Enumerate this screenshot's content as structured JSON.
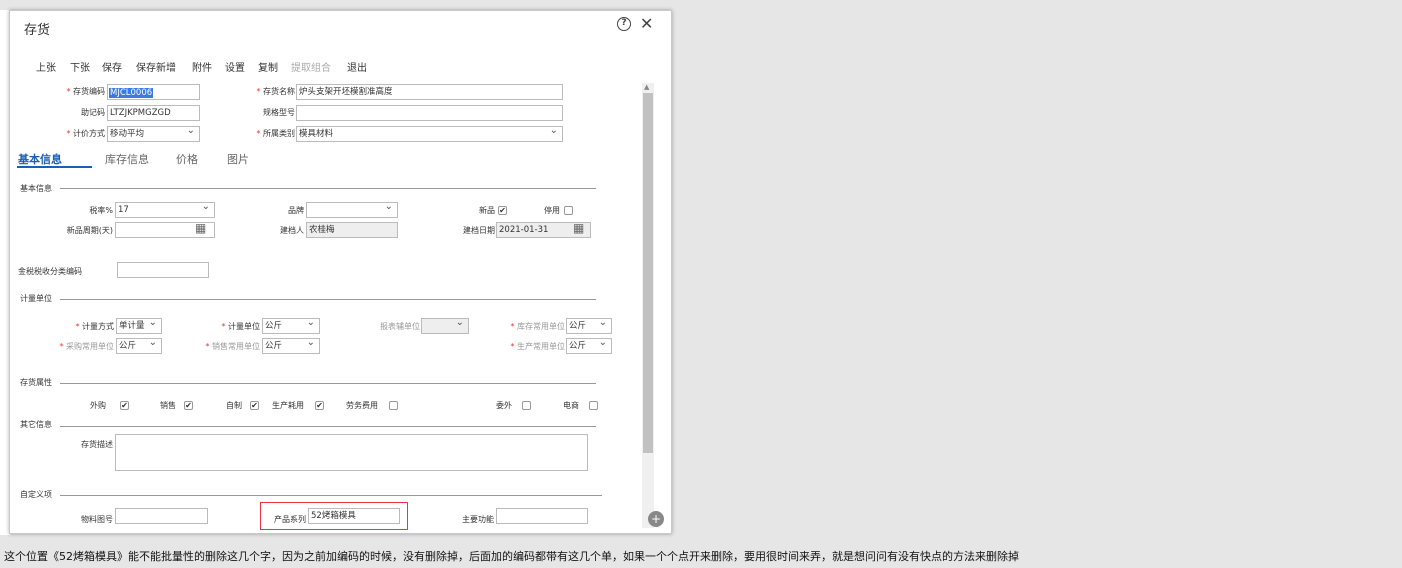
{
  "dialog": {
    "title": "存货",
    "help": "?",
    "close": "✕"
  },
  "toolbar": {
    "items": [
      "上张",
      "下张",
      "保存",
      "保存新增",
      "附件",
      "设置",
      "复制",
      "提取组合",
      "退出"
    ]
  },
  "header": {
    "code_label": "存货编码",
    "code_value": "MJCL0006",
    "name_label": "存货名称",
    "name_value": "炉头支架开坯模割准高度",
    "mnemonic_label": "助记码",
    "mnemonic_value": "LTZJKPMGZGD",
    "spec_label": "规格型号",
    "spec_value": "",
    "pricing_label": "计价方式",
    "pricing_value": "移动平均",
    "category_label": "所属类别",
    "category_value": "模具材料"
  },
  "tabs": [
    "基本信息",
    "库存信息",
    "价格",
    "图片"
  ],
  "basic": {
    "section": "基本信息",
    "tax_label": "税率%",
    "tax_value": "17",
    "brand_label": "品牌",
    "brand_value": "",
    "newproduct_label": "新品",
    "disabled_label": "停用",
    "cycle_label": "新品周期(天)",
    "cycle_value": "",
    "creator_label": "建档人",
    "creator_value": "农桂梅",
    "date_label": "建档日期",
    "date_value": "2021-01-31",
    "taxcode_label": "金税税收分类编码",
    "taxcode_value": ""
  },
  "units": {
    "section": "计量单位",
    "method_label": "计量方式",
    "method_value": "单计量",
    "unit_label": "计量单位",
    "unit_value": "公斤",
    "report_label": "报表辅单位",
    "report_value": "",
    "stock_label": "库存常用单位",
    "stock_value": "公斤",
    "purchase_label": "采购常用单位",
    "purchase_value": "公斤",
    "sales_label": "销售常用单位",
    "sales_value": "公斤",
    "production_label": "生产常用单位",
    "production_value": "公斤"
  },
  "attrs": {
    "section": "存货属性",
    "outsourcing": "外购",
    "sales": "销售",
    "selfmade": "自制",
    "production": "生产耗用",
    "labor": "劳务费用",
    "entrust": "委外",
    "ecommerce": "电商"
  },
  "other": {
    "section": "其它信息",
    "desc_label": "存货描述",
    "desc_value": ""
  },
  "custom": {
    "section": "自定义项",
    "drawing_label": "物料图号",
    "drawing_value": "",
    "series_label": "产品系列",
    "series_value": "52烤箱模具",
    "function_label": "主要功能",
    "function_value": ""
  },
  "caption": "这个位置《52烤箱模具》能不能批量性的删除这几个字，因为之前加编码的时候，没有删除掉，后面加的编码都带有这几个单，如果一个个点开来删除，要用很时间来弄，就是想问问有没有快点的方法来删除掉",
  "icons": {
    "checkmark": "✔",
    "calendar": "▦",
    "calendar2": "📅",
    "zoom": "+"
  }
}
